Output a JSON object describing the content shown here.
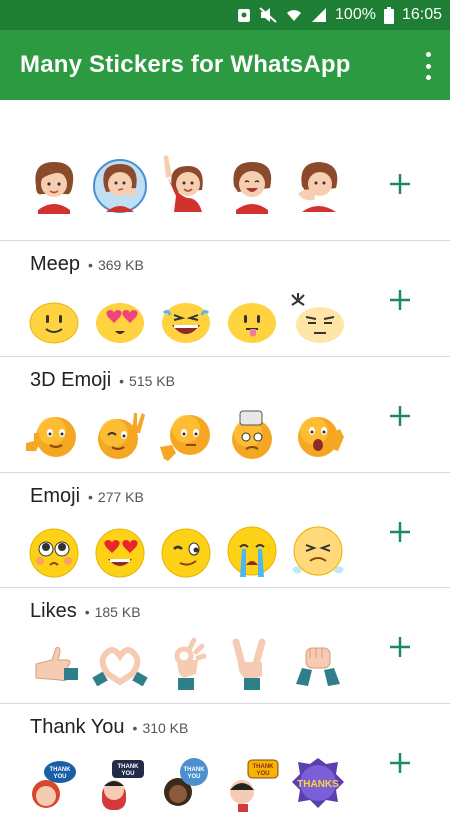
{
  "statusbar": {
    "battery": "100%",
    "time": "16:05"
  },
  "appbar": {
    "title": "Many Stickers for WhatsApp"
  },
  "colors": {
    "primary": "#2c9a41",
    "primary_dark": "#1e7e34",
    "accent": "#1a8a6e"
  },
  "packs": [
    {
      "name": "",
      "size": "",
      "stickers": [
        "girl-hair-icon",
        "girl-thinking-icon",
        "girl-waving-icon",
        "girl-laughing-icon",
        "girl-shy-icon"
      ]
    },
    {
      "name": "Meep",
      "size": "369 KB",
      "stickers": [
        "smile-icon",
        "heart-eyes-icon",
        "laugh-tears-icon",
        "tongue-icon",
        "angry-vein-icon"
      ]
    },
    {
      "name": "3D Emoji",
      "size": "515 KB",
      "stickers": [
        "thumbs-up-emoji-icon",
        "peace-emoji-icon",
        "pointing-emoji-icon",
        "dizzy-emoji-icon",
        "surprised-emoji-icon"
      ]
    },
    {
      "name": "Emoji",
      "size": "277 KB",
      "stickers": [
        "pleading-icon",
        "heart-eyes-emoji-icon",
        "winking-icon",
        "crying-icon",
        "sneezing-icon"
      ]
    },
    {
      "name": "Likes",
      "size": "185 KB",
      "stickers": [
        "thumbs-up-hand-icon",
        "heart-hands-icon",
        "ok-hand-icon",
        "victory-hand-icon",
        "fist-bump-icon"
      ]
    },
    {
      "name": "Thank You",
      "size": "310 KB",
      "stickers": [
        "thank-you-girl-icon",
        "thank-you-boy-icon",
        "thank-you-woman-icon",
        "thank-you-kid-icon",
        "thanks-badge-icon"
      ]
    }
  ]
}
